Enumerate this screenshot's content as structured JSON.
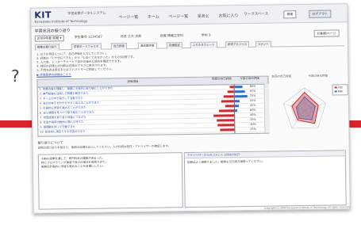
{
  "overlay": {
    "question_mark": "?"
  },
  "header": {
    "logo": "KIT",
    "logo_sub": "Kanazawa Institute of Technology",
    "system_name": "学習支援ポータルシステム",
    "nav": [
      "ページー覧",
      "ホーム",
      "ページー覧",
      "足あと",
      "お気に入り"
    ],
    "right_text": "ワークスペース",
    "btn1": "検索",
    "btn2": "ログアウト"
  },
  "page": {
    "title": "学習状況の振り返り",
    "filter_value": "2009年度 前期 ▾",
    "info": [
      "学生番号 1234567",
      "氏名 工大 太郎",
      "所属 情報工学科",
      "学年 3"
    ],
    "print_button": "印刷用ページ"
  },
  "tabs": [
    "授業の振り返り",
    "学習ポートフォリオ",
    "自己評価",
    "達成度評価",
    "目標設定",
    "ふりかえりシート",
    "修学アドバイス",
    "コメント"
  ],
  "active_tab": 3,
  "description": [
    "1. 以下の項目について、自己評価を入力してください。",
    "2. 評価は「5:十分にできた」から「1:全くできなかった」までの5段階です。",
    "3. 入力後、レーダーチャートで自分の強みと弱みを確認できます。",
    "4. 前回の評価との比較は右側のグラフに表示されます。",
    "5. 不明な点は担任またはアドバイザーに相談してください。"
  ],
  "description_link": "▶ 評価基準の詳細はこちら",
  "table": {
    "header_item": "評価項目",
    "header_prev": "前回の自己評価",
    "header_cur": "今回の自己評価",
    "rows": [
      {
        "label": "1. 授業内容を理解し、課題に主体的に取り組むことができた",
        "pct": "80%"
      },
      {
        "label": "2. 専門知識を活用して問題を解決できた",
        "pct": "65%"
      },
      {
        "label": "3. チームの中で協力して活動できた",
        "pct": "75%"
      },
      {
        "label": "4. 自分の考えをわかりやすく伝えることができた",
        "pct": "55%"
      },
      {
        "label": "5. 計画的に学習を進めることができた",
        "pct": "45%"
      },
      {
        "label": "6. 自ら課題を見つけて取り組むことができた",
        "pct": "60%"
      },
      {
        "label": "7. 学習成果を振り返り改善につなげた",
        "pct": "40%"
      },
      {
        "label": "8. 社会や技術の動向に関心を持てた",
        "pct": "35%"
      },
      {
        "label": "9. 倫理観を持って行動できた",
        "pct": "30%"
      },
      {
        "label": "10. 総合的に満足できる学習ができた",
        "pct": "25%"
      }
    ]
  },
  "chart_data": {
    "type": "bar",
    "orientation": "horizontal",
    "categories": [
      "1",
      "2",
      "3",
      "4",
      "5",
      "6",
      "7",
      "8",
      "9",
      "10"
    ],
    "series": [
      {
        "values": [
          3,
          5,
          8,
          10,
          7,
          12,
          16,
          14,
          13,
          11
        ]
      },
      {
        "values": [
          6,
          8,
          10,
          4,
          3,
          2,
          0,
          0,
          0,
          0
        ]
      }
    ],
    "colors": [
      "#cc2a2f",
      "#2f6fce"
    ]
  },
  "radar": {
    "title_left": "前回の自己評価",
    "title_right": "今回の自己評価",
    "legend": [
      "今回",
      "前回"
    ],
    "axes": [
      "A",
      "B",
      "C",
      "D",
      "E"
    ],
    "current": [
      0.8,
      0.65,
      0.75,
      0.55,
      0.6
    ],
    "previous": [
      0.6,
      0.5,
      0.55,
      0.45,
      0.4
    ],
    "colors": {
      "current": "#cc2a2f",
      "previous": "#2f6fce"
    }
  },
  "comments": {
    "title": "振り返りについて",
    "note": "前期の振り返りを踏まえ、後期の目標を記入してください。入力内容は担任・アドバイザーが確認します。",
    "left_lines": [
      "今期の授業を通して、専門科目の理解が深まった。",
      "特にプログラミング演習で自分の強みを発見できた。",
      "後期は計画的に学習を進めることを目標にしたい。"
    ],
    "right_header": "アドバイザーからのコメント  2009/09/25",
    "right_lines": [
      "前期はよく頑張りました。後期も引き続き頑張ってください。"
    ]
  },
  "footer": "Copyright(C) 2009 Kanazawa Institute of Technology. All rights reserved."
}
